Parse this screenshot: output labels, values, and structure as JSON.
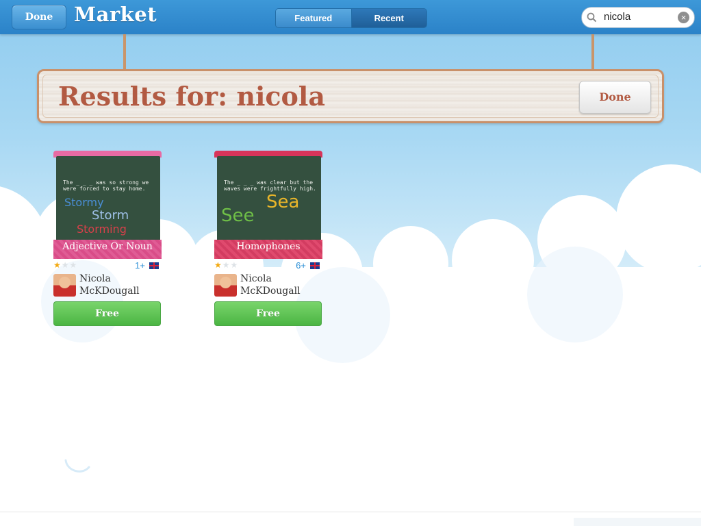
{
  "header": {
    "done_label": "Done",
    "title": "Market",
    "tabs": [
      {
        "label": "Featured",
        "selected": false
      },
      {
        "label": "Recent",
        "selected": true
      }
    ],
    "search": {
      "value": "nicola",
      "icon": "search-icon",
      "clear_icon": "clear-icon"
    }
  },
  "results": {
    "heading": "Results for: nicola",
    "done_label": "Done"
  },
  "products": [
    {
      "title": "Adjective Or Noun",
      "chalk_sentence": "The _ _ _ was so strong we were forced to stay home.",
      "chalk_words": [
        "Stormy",
        "Storm",
        "Storming"
      ],
      "rating": 1,
      "age": "1+",
      "language_icon": "uk-flag-icon",
      "author": "Nicola McKDougall",
      "price_label": "Free"
    },
    {
      "title": "Homophones",
      "chalk_sentence": "The _ _ _ was clear but the waves were frightfully high.",
      "chalk_words": [
        "See",
        "Sea"
      ],
      "rating": 1,
      "age": "6+",
      "language_icon": "uk-flag-icon",
      "author": "Nicola McKDougall",
      "price_label": "Free"
    }
  ],
  "colors": {
    "header_blue": "#2b82c8",
    "accent_brown": "#b25a42",
    "buy_green": "#4bb543",
    "star_gold": "#f3a90f"
  }
}
